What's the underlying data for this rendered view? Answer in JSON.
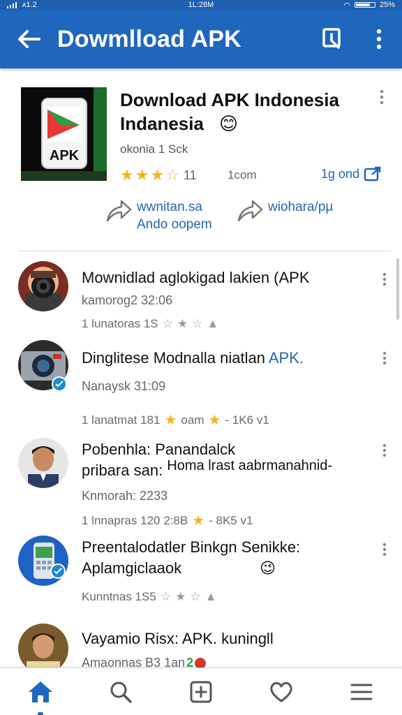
{
  "status_bar": {
    "left": "ᴀ1.2",
    "time": "1L:28M",
    "right": "25%"
  },
  "app_bar": {
    "title": "Dowmlload APK"
  },
  "featured": {
    "title_line1": "Download APK Indonesia",
    "title_line2": "Indanesia",
    "emoji": "😊",
    "subtitle": "okonia 1 Sck",
    "rating_count": "11",
    "size": "1com",
    "link_label": "1g ond",
    "icon_label": "APK",
    "share_a_line1": "wwnitan.sa",
    "share_a_line2": "Ando oopem",
    "share_b_line1": "wiohara/pµ"
  },
  "items": [
    {
      "title": "Mownidlad aglokigad lakien (APK",
      "subtitle": "kamorog2 32:06",
      "meta": "1 lunatoras 1S"
    },
    {
      "title": "Dinglitese Modnalla niatlan",
      "title_accent": "APK.",
      "subtitle": "Nanaysk 31:09",
      "meta_a": "1 lanatmat 181",
      "meta_b": "oam",
      "meta_c": "- 1K6 v1"
    },
    {
      "title_line1": "Pobenhla: Panandalck",
      "title_line2": "pribara san:",
      "title_tail": "Homa lrast aabrmanahnid-",
      "subtitle": "Knmorah: 2233",
      "meta_a": "1 lnnapras 120 2:8B",
      "meta_b": "- 8K5 v1"
    },
    {
      "title_line1": "Preentalodatler Binkgn Senikke:",
      "title_line2": "Aplamgiclaaok",
      "emoji": "😉",
      "meta": "Kunntnas 1S5"
    },
    {
      "title": "Vayamio Risx: APK. kuningll",
      "subtitle": "Amaonnas B3 1an",
      "badge_num": "2"
    }
  ],
  "colors": {
    "primary": "#1f66bd",
    "star": "#f3b51b",
    "link": "#2466b0"
  }
}
